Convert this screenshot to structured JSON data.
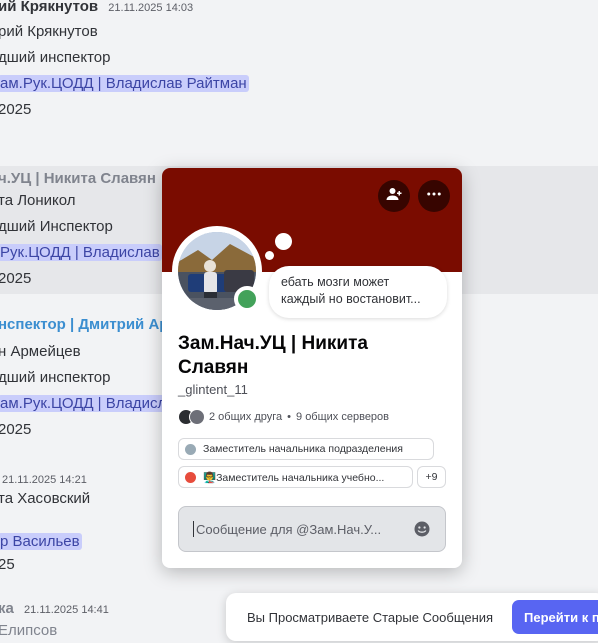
{
  "messages": [
    {
      "author": "ий Крякнутов",
      "timestamp": "21.11.2025 14:03",
      "lines": [
        "рий Крякнутов",
        "дший инспектор",
        "ам.Рук.ЦОДД | Владислав Райтман",
        "2025"
      ]
    },
    {
      "author": "ч.УЦ | Никита Славян",
      "lines": [
        "та Лоникол",
        "дший Инспектор",
        "Рук.ЦОДД | Владислав",
        "2025"
      ]
    },
    {
      "author": "нспектор | Дмитрий Арм",
      "lines": [
        "н Армейцев",
        "дший инспектор",
        "ам.Рук.ЦОДД | Владисл",
        "2025"
      ]
    },
    {
      "timestamp": "21.11.2025 14:21",
      "lines": [
        "та Хасовский",
        "р Васильев",
        "25"
      ]
    },
    {
      "author": "ка",
      "timestamp": "21.11.2025 14:41",
      "lines": [
        "Елипсов"
      ]
    }
  ],
  "popout": {
    "banner_color": "#7a0c00",
    "add_friend_icon": "add-friend-icon",
    "more_icon": "more-icon",
    "status_note": "ебать мозги может каждый но востановит...",
    "display_name": "Зам.Нач.УЦ | Никита Славян",
    "username": "_glintent_11",
    "mutual_friends": "2 общих друга",
    "separator": "•",
    "mutual_servers": "9 общих серверов",
    "roles": [
      {
        "name": "Заместитель начальника подразделения",
        "color": "#99aab5"
      },
      {
        "name": "👨‍🏫Заместитель начальника учебно...",
        "color": "#e74c3c"
      }
    ],
    "more_roles": "+9",
    "message_placeholder": "Сообщение для @Зам.Нач.У...",
    "status_color": "#43a25a"
  },
  "toast": {
    "text": "Вы Просматриваете Старые Сообщения",
    "button": "Перейти к п"
  }
}
